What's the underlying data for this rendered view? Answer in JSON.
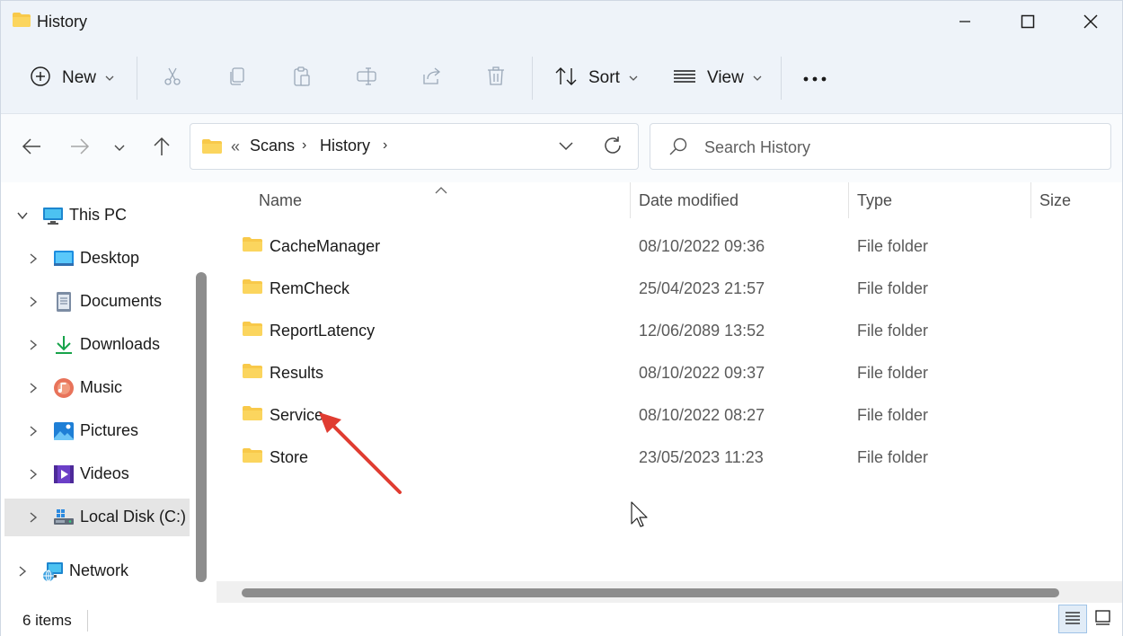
{
  "window": {
    "title": "History"
  },
  "toolbar": {
    "new_label": "New",
    "sort_label": "Sort",
    "view_label": "View"
  },
  "address": {
    "overflow": "«",
    "crumbs": [
      "Scans",
      "History"
    ],
    "separator": "›"
  },
  "search": {
    "placeholder": "Search History"
  },
  "sidebar": {
    "items": [
      {
        "label": "This PC",
        "icon": "monitor-icon",
        "expanded": true
      },
      {
        "label": "Desktop",
        "icon": "desktop-icon"
      },
      {
        "label": "Documents",
        "icon": "documents-icon"
      },
      {
        "label": "Downloads",
        "icon": "download-icon"
      },
      {
        "label": "Music",
        "icon": "music-icon"
      },
      {
        "label": "Pictures",
        "icon": "pictures-icon"
      },
      {
        "label": "Videos",
        "icon": "videos-icon"
      },
      {
        "label": "Local Disk (C:)",
        "icon": "drive-icon",
        "selected": true
      },
      {
        "label": "Network",
        "icon": "network-icon"
      }
    ]
  },
  "columns": {
    "name": "Name",
    "date": "Date modified",
    "type": "Type",
    "size": "Size"
  },
  "files": [
    {
      "name": "CacheManager",
      "date": "08/10/2022 09:36",
      "type": "File folder"
    },
    {
      "name": "RemCheck",
      "date": "25/04/2023 21:57",
      "type": "File folder"
    },
    {
      "name": "ReportLatency",
      "date": "12/06/2089 13:52",
      "type": "File folder"
    },
    {
      "name": "Results",
      "date": "08/10/2022 09:37",
      "type": "File folder"
    },
    {
      "name": "Service",
      "date": "08/10/2022 08:27",
      "type": "File folder"
    },
    {
      "name": "Store",
      "date": "23/05/2023 11:23",
      "type": "File folder"
    }
  ],
  "status": {
    "item_count": "6 items"
  },
  "colors": {
    "folder": "#f8c94a",
    "accent": "#0067c0",
    "annotation_arrow": "#e03c31"
  }
}
